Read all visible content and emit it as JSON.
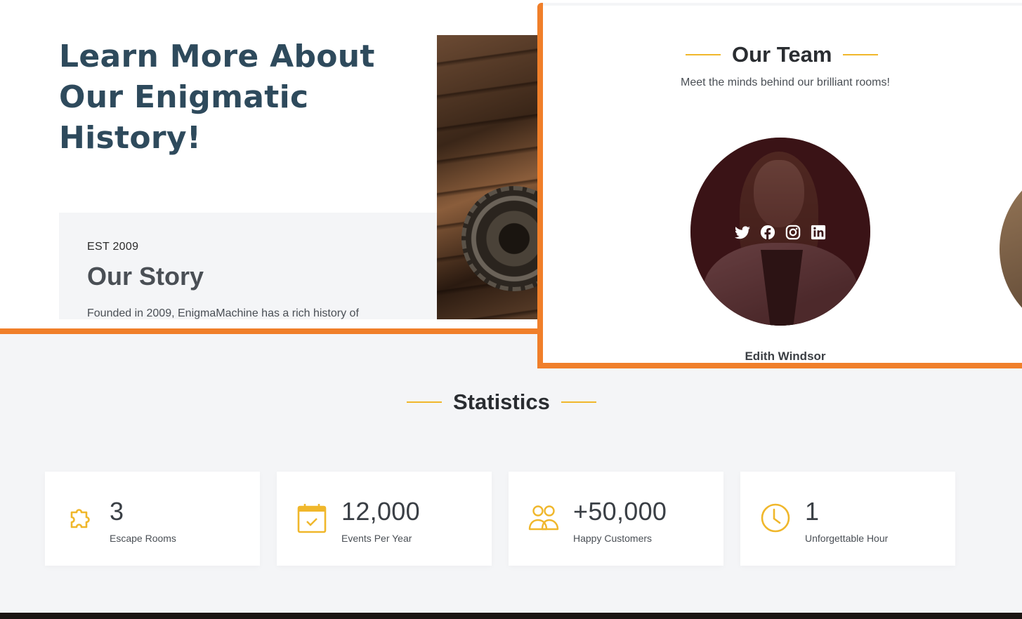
{
  "hero": {
    "title": "Learn More About Our Enigmatic History!",
    "story": {
      "established": "EST 2009",
      "title": "Our Story",
      "text": "Founded in 2009, EnigmaMachine has a rich history of"
    }
  },
  "team": {
    "heading": "Our Team",
    "subheading": "Meet the minds behind our brilliant rooms!",
    "member": {
      "name": "Edith Windsor",
      "socials": [
        "twitter-icon",
        "facebook-icon",
        "instagram-icon",
        "linkedin-icon"
      ]
    }
  },
  "statistics": {
    "heading": "Statistics",
    "items": [
      {
        "value": "3",
        "label": "Escape Rooms",
        "icon": "puzzle-icon"
      },
      {
        "value": "12,000",
        "label": "Events Per Year",
        "icon": "calendar-check-icon"
      },
      {
        "value": "+50,000",
        "label": "Happy Customers",
        "icon": "users-icon"
      },
      {
        "value": "1",
        "label": "Unforgettable Hour",
        "icon": "clock-icon"
      }
    ]
  },
  "colors": {
    "accent_orange": "#f07f2a",
    "accent_yellow": "#f0b72b",
    "title_dark": "#2e4a5c",
    "section_bg": "#f4f5f7"
  }
}
